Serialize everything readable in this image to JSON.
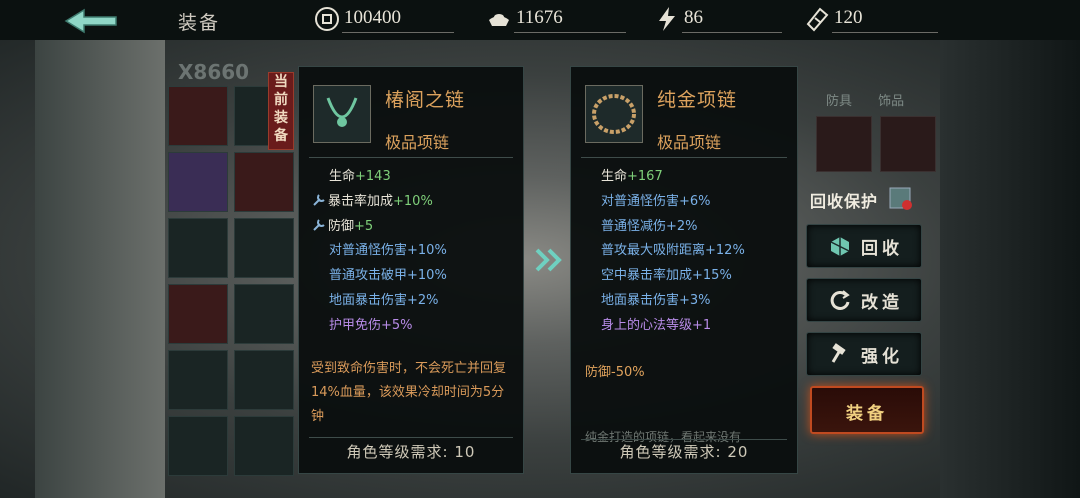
{
  "header": {
    "title": "装备",
    "resources": [
      {
        "icon": "coin-icon",
        "value": "100400"
      },
      {
        "icon": "silver-ingot-icon",
        "value": "11676"
      },
      {
        "icon": "energy-bolt-icon",
        "value": "86"
      },
      {
        "icon": "ticket-icon",
        "value": "120"
      }
    ]
  },
  "inventory": {
    "count_label": "X8660",
    "current_badge": "当前装备"
  },
  "current_item": {
    "name": "椿阁之链",
    "grade": "极品项链",
    "stats": [
      {
        "key": "生命",
        "val": "+143",
        "color": "green",
        "icon": ""
      },
      {
        "key": "暴击率加成",
        "val": "+10%",
        "color": "green",
        "icon": "wrench-icon"
      },
      {
        "key": "防御",
        "val": "+5",
        "color": "green",
        "icon": "wrench-icon"
      },
      {
        "key": "对普通怪伤害",
        "val": "+10%",
        "color": "blue",
        "icon": ""
      },
      {
        "key": "普通攻击破甲",
        "val": "+10%",
        "color": "blue",
        "icon": ""
      },
      {
        "key": "地面暴击伤害",
        "val": "+2%",
        "color": "blue",
        "icon": ""
      },
      {
        "key": "护甲免伤",
        "val": "+5%",
        "color": "purple",
        "icon": ""
      }
    ],
    "description": "受到致命伤害时，不会死亡并回复14%血量，该效果冷却时间为5分钟",
    "requirement": "角色等级需求: 10"
  },
  "compare_item": {
    "name": "纯金项链",
    "grade": "极品项链",
    "stats": [
      {
        "key": "生命",
        "val": "+167",
        "color": "green"
      },
      {
        "key": "对普通怪伤害",
        "val": "+6%",
        "color": "blue"
      },
      {
        "key": "普通怪减伤",
        "val": "+2%",
        "color": "blue"
      },
      {
        "key": "普攻最大吸附距离",
        "val": "+12%",
        "color": "blue"
      },
      {
        "key": "空中暴击率加成",
        "val": "+15%",
        "color": "blue"
      },
      {
        "key": "地面暴击伤害",
        "val": "+3%",
        "color": "blue"
      },
      {
        "key": "身上的心法等级",
        "val": "+1",
        "color": "purple"
      }
    ],
    "diff_key": "防御",
    "diff_val": "-50%",
    "flavor": "纯金打造的项链，看起来没有",
    "requirement": "角色等级需求: 20"
  },
  "right_panel": {
    "tabs": [
      "防具",
      "饰品"
    ],
    "recycle_protect_label": "回收保护",
    "buttons": {
      "recycle": "回收",
      "reforge": "改造",
      "enhance": "强化",
      "equip": "装备"
    }
  },
  "colors": {
    "accent_orange": "#dca25d",
    "stat_green": "#7fd07a",
    "stat_blue": "#7ab1e8",
    "stat_purple": "#b88ce8",
    "equip_border": "#c04a20"
  }
}
